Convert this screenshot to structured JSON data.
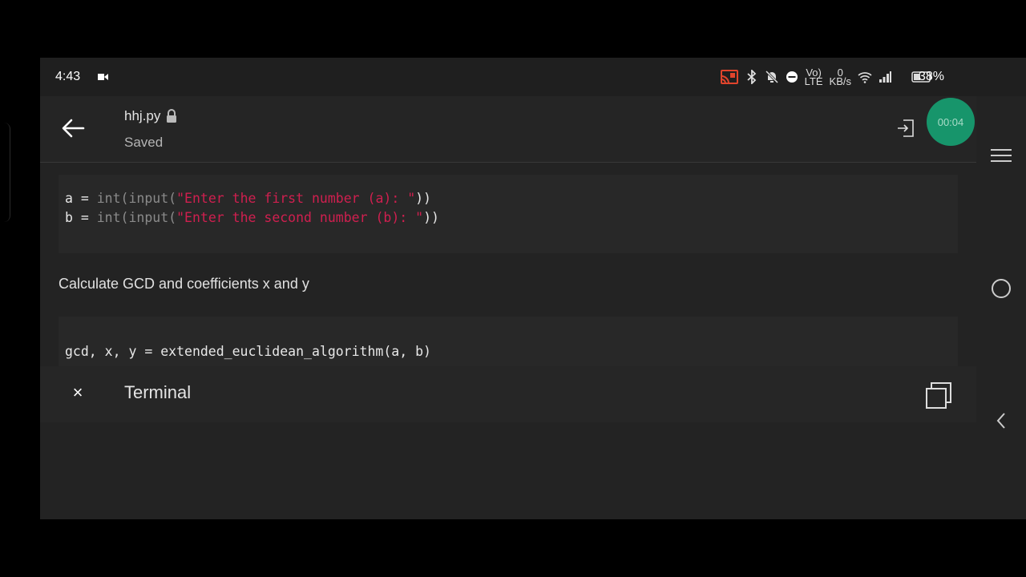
{
  "status_bar": {
    "time": "4:43",
    "network_labels": [
      "Vo)",
      "LTE"
    ],
    "speed_value": "0",
    "speed_unit": "KB/s",
    "battery": "38%"
  },
  "app_bar": {
    "file_name": "hhj.py",
    "file_status": "Saved",
    "timer": "00:04"
  },
  "cells": {
    "code1": {
      "line1": {
        "a": "a = ",
        "int": "int(",
        "input": "input(",
        "str": "\"Enter the first number (a): \"",
        "close": "))"
      },
      "line2": {
        "a": "b = ",
        "int": "int(",
        "input": "input(",
        "str": "\"Enter the second number (b): \"",
        "close": "))"
      }
    },
    "markdown": "Calculate GCD and coefficients x and y",
    "code2": {
      "line1": "gcd, x, y = extended_euclidean_algorithm(a, b)"
    }
  },
  "terminal": {
    "close_label": "×",
    "title": "Terminal"
  },
  "icons": {
    "back": "back-arrow-icon",
    "lock": "lock-icon",
    "exit": "exit-icon",
    "menu": "menu-icon",
    "home": "home-circle-icon",
    "nav_back": "chevron-left-icon",
    "copy": "copy-icon"
  },
  "colors": {
    "timer": "#17956b",
    "string": "#d01f4f",
    "cast": "#e0442c"
  }
}
